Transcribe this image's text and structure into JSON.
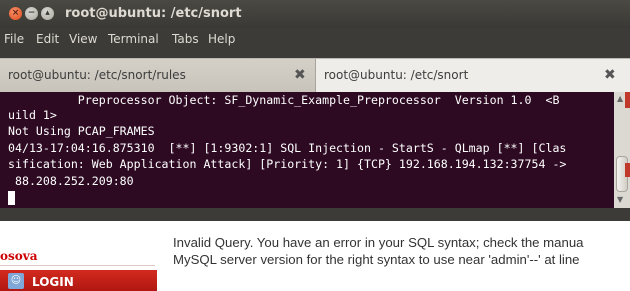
{
  "window": {
    "title": "root@ubuntu: /etc/snort",
    "close_glyph": "×",
    "min_glyph": "−",
    "max_glyph": "▴"
  },
  "menu": {
    "items": [
      "File",
      "Edit",
      "View",
      "Terminal",
      "Tabs",
      "Help"
    ]
  },
  "tabs": [
    {
      "label": "root@ubuntu: /etc/snort/rules",
      "close": "✖"
    },
    {
      "label": "root@ubuntu: /etc/snort",
      "close": "✖"
    }
  ],
  "terminal": {
    "lines": [
      "          Preprocessor Object: SF_Dynamic_Example_Preprocessor  Version 1.0  <B",
      "uild 1>",
      "Not Using PCAP_FRAMES",
      "04/13-17:04:16.875310  [**] [1:9302:1] SQL Injection - StartS - QLmap [**] [Clas",
      "sification: Web Application Attack] [Priority: 1] {TCP} 192.168.194.132:37754 ->",
      " 88.208.252.209:80"
    ]
  },
  "scrollbar": {
    "up": "▲",
    "down": "▼"
  },
  "website": {
    "brand": "osova",
    "login_label": "LOGIN",
    "login_icon": "user-icon",
    "error_lines": [
      "Invalid Query. You have an error in your SQL syntax; check the manua",
      "MySQL server version for the right syntax to use near 'admin'--' at line"
    ]
  },
  "colors": {
    "terminal_bg": "#2d0a22",
    "title_bg": "#3c3b37",
    "close_button": "#df4a16",
    "login_bar": "#c8201a",
    "brand": "#cc0000"
  }
}
